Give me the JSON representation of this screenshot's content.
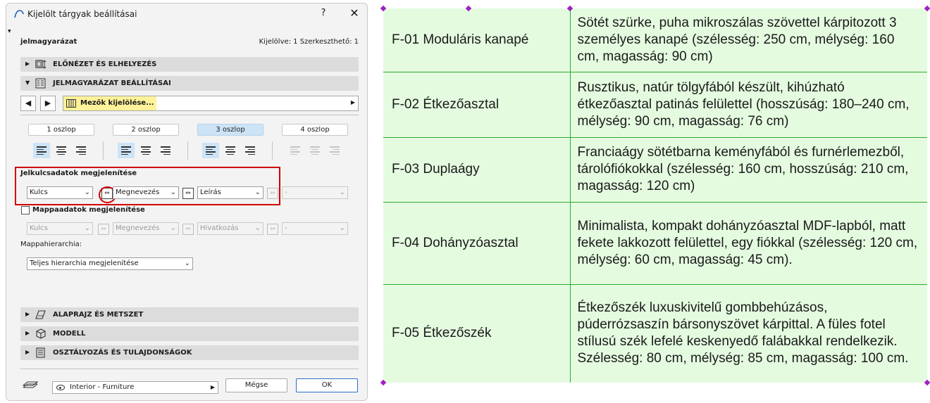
{
  "dialog": {
    "title": "Kijelölt tárgyak beállításai",
    "help_label": "?",
    "close_label": "✕",
    "section_name": "jelmagyarázat",
    "selection_info": "Kijelölve: 1 Szerkeszthető: 1",
    "sections": {
      "preview": "ELŐNÉZET ÉS ELHELYEZÉS",
      "legend_settings": "JELMAGYARÁZAT BEÁLLÍTÁSAI",
      "floor_plan": "ALAPRAJZ ÉS METSZET",
      "model": "MODELL",
      "classification": "OSZTÁLYOZÁS ÉS TULAJDONSÁGOK"
    },
    "field_selector": "Mezők kijelölése...",
    "columns": [
      "1 oszlop",
      "2 oszlop",
      "3 oszlop",
      "4 oszlop"
    ],
    "key_data": {
      "label": "Jelkulcsadatok megjelenítése",
      "fields": [
        "Kulcs",
        "Megnevezés",
        "Leírás",
        "-"
      ]
    },
    "folder_data": {
      "label": "Mappaadatok megjelenítése",
      "fields": [
        "Kulcs",
        "Megnevezés",
        "Hivatkozás",
        "-"
      ]
    },
    "hierarchy": {
      "label": "Mappahierarchia:",
      "value": "Teljes hierarchia megjelenítése"
    },
    "footer": {
      "layer": "Interior - Furniture",
      "cancel": "Mégse",
      "ok": "OK"
    }
  },
  "legend": {
    "rows": [
      {
        "code": "F-01 Moduláris kanapé",
        "description": "Sötét szürke, puha mikroszálas szövettel kárpitozott 3 személyes kanapé (szélesség: 250 cm, mélység: 160 cm, magasság: 90 cm)"
      },
      {
        "code": "F-02 Étkezőasztal",
        "description": "Rusztikus, natúr tölgyfából készült, kihúzható étkezőasztal patinás felülettel (hosszúság: 180–240 cm, mélység: 90 cm, magasság: 76 cm)"
      },
      {
        "code": "F-03 Duplaágy",
        "description": "Franciaágy sötétbarna keményfából és furnérlemezből, tárolófiókokkal (szélesség: 160 cm, hosszúság: 210 cm, magasság: 120 cm)"
      },
      {
        "code": "F-04 Dohányzóasztal",
        "description": "Minimalista, kompakt dohányzóasztal MDF-lapból, matt fekete lakkozott felülettel, egy fiókkal (szélesség: 120 cm, mélység: 60 cm, magasság: 45 cm)."
      },
      {
        "code": "F-05 Étkezőszék",
        "description": "Étkezőszék luxuskivitelű gombbehúzásos, púderrózsaszín bársonyszövet kárpittal. A füles fotel stílusú szék lefelé keskenyedő falábakkal rendelkezik. Szélesség: 80 cm, mélység: 85 cm, magasság: 100 cm."
      }
    ]
  }
}
